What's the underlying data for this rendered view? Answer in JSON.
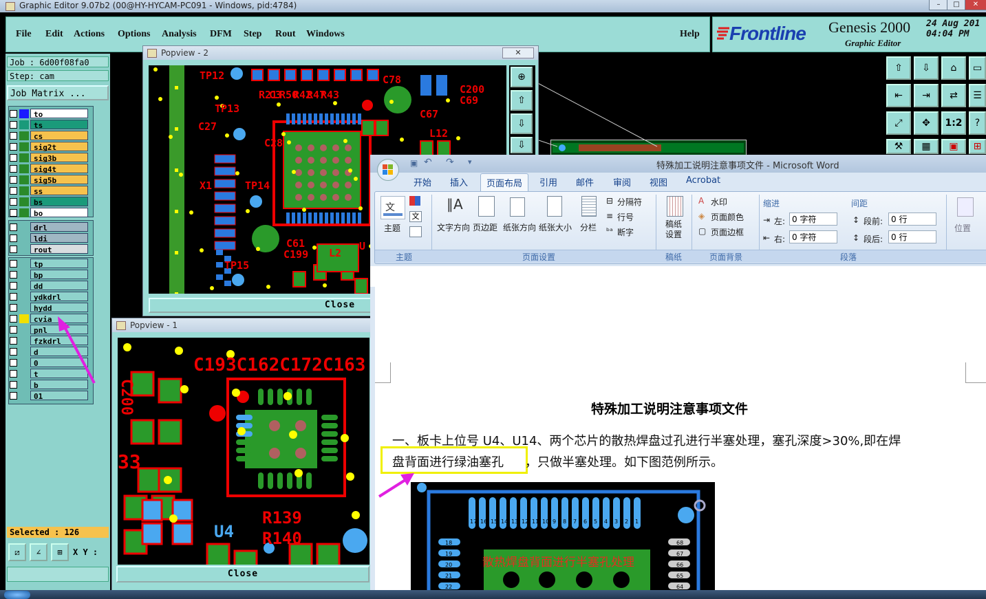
{
  "window": {
    "title": "Graphic Editor 9.07b2 (00@HY-HYCAM-PC091 - Windows, pid:4784)"
  },
  "menu": {
    "items": [
      "File",
      "Edit",
      "Actions",
      "Options",
      "Analysis",
      "DFM",
      "Step",
      "Rout",
      "Windows"
    ],
    "help": "Help"
  },
  "brand": {
    "logo": "Frontline",
    "product": "Genesis 2000",
    "subtitle": "Graphic Editor",
    "date": "24 Aug 201",
    "time": "04:04 PM"
  },
  "left": {
    "job": "Job  : 6d00f08fa0",
    "step": "Step: cam",
    "job_matrix": "Job Matrix ...",
    "layers_board": [
      {
        "name": "to",
        "color": "#ffffff",
        "swatch": "#1a1aff"
      },
      {
        "name": "ts",
        "color": "#1a9a7a",
        "swatch": "#1a9a7a"
      },
      {
        "name": "cs",
        "color": "#f6c24d",
        "swatch": "#2a8a2a"
      },
      {
        "name": "sig2t",
        "color": "#f6c24d",
        "swatch": "#2a8a2a"
      },
      {
        "name": "sig3b",
        "color": "#f6c24d",
        "swatch": "#2a8a2a"
      },
      {
        "name": "sig4t",
        "color": "#f6c24d",
        "swatch": "#2a8a2a"
      },
      {
        "name": "sig5b",
        "color": "#f6c24d",
        "swatch": "#2a8a2a"
      },
      {
        "name": "ss",
        "color": "#f6c24d",
        "swatch": "#2a8a2a"
      },
      {
        "name": "bs",
        "color": "#1a9a7a",
        "swatch": "#2a8a2a"
      },
      {
        "name": "bo",
        "color": "#ffffff",
        "swatch": "#2a8a2a"
      }
    ],
    "layers_drill": [
      {
        "name": "drl",
        "color": "#9fb7c3"
      },
      {
        "name": "ldi",
        "color": "#9fb7c3"
      },
      {
        "name": "rout",
        "color": "#d8dde0"
      }
    ],
    "layers_misc": [
      {
        "name": "tp"
      },
      {
        "name": "bp"
      },
      {
        "name": "dd"
      },
      {
        "name": "ydkdrl"
      },
      {
        "name": "hydd"
      },
      {
        "name": "cvia",
        "swatch": "#f0e000"
      },
      {
        "name": "pnl"
      },
      {
        "name": "fzkdrl"
      },
      {
        "name": "d"
      },
      {
        "name": "0"
      },
      {
        "name": "t"
      },
      {
        "name": "b"
      },
      {
        "name": "01"
      }
    ],
    "selected": "Selected : 126",
    "xy_label": "X Y :"
  },
  "popview2": {
    "title": "Popview - 2",
    "close": "Close",
    "labels": [
      "TP12",
      "C78",
      "R21",
      "C3",
      "R50",
      "R42",
      "R47",
      "R43",
      "C200",
      "C69",
      "TP13",
      "C27",
      "C28",
      "C67",
      "L12",
      "X1",
      "TP14",
      "C61",
      "C199",
      "L2",
      "U",
      "TP15"
    ]
  },
  "popview1": {
    "title": "Popview - 1",
    "close": "Close",
    "labels": [
      "C193C162C172C163",
      "C200",
      "33",
      "U4",
      "R139",
      "R140"
    ]
  },
  "word": {
    "title": "特殊加工说明注意事项文件  -  Microsoft Word",
    "tabs": [
      "开始",
      "插入",
      "页面布局",
      "引用",
      "邮件",
      "审阅",
      "视图",
      "Acrobat"
    ],
    "active_tab": "页面布局",
    "groups": {
      "theme": {
        "label": "主题",
        "btn": "主题",
        "text_icon": "文"
      },
      "page_setup": {
        "label": "页面设置",
        "buttons": [
          "文字方向",
          "页边距",
          "纸张方向",
          "纸张大小",
          "分栏"
        ],
        "small": [
          "分隔符",
          "行号",
          "断字"
        ]
      },
      "draft": {
        "label": "稿纸",
        "btn": "稿纸\n设置"
      },
      "bg": {
        "label": "页面背景",
        "items": [
          "水印",
          "页面颜色",
          "页面边框"
        ]
      },
      "para": {
        "label": "段落",
        "indent": "缩进",
        "spacing": "间距",
        "left": "左:",
        "right": "右:",
        "before": "段前:",
        "after": "段后:",
        "v_left": "0 字符",
        "v_right": "0 字符",
        "v_before": "0 行",
        "v_after": "0 行"
      },
      "arrange": {
        "btn": "位置"
      }
    },
    "doc": {
      "heading": "特殊加工说明注意事项文件",
      "line1": "一、板卡上位号 U4、U14、两个芯片的散热焊盘过孔进行半塞处理，塞孔深度>30%,即在焊",
      "line2a": "盘背面进行绿油塞孔",
      "line2b": "，只做半塞处理。如下图范例所示。",
      "image_caption": "散热焊盘背面进行半塞孔处理",
      "pin_top": [
        "17",
        "16",
        "15",
        "14",
        "13",
        "12",
        "11",
        "10",
        "9",
        "8",
        "7",
        "6",
        "5",
        "4",
        "3",
        "2",
        "1"
      ],
      "pin_left": [
        "18",
        "19",
        "20",
        "21",
        "22"
      ],
      "pin_right": [
        "68",
        "67",
        "66",
        "65",
        "64"
      ]
    }
  },
  "colors": {
    "panel": "#9bdcd6",
    "accent_red": "#e00000",
    "pcb_green": "#2a9a2a",
    "pad_blue": "#2a7adf",
    "arrow": "#e020e0",
    "highlight": "#f0f000"
  }
}
